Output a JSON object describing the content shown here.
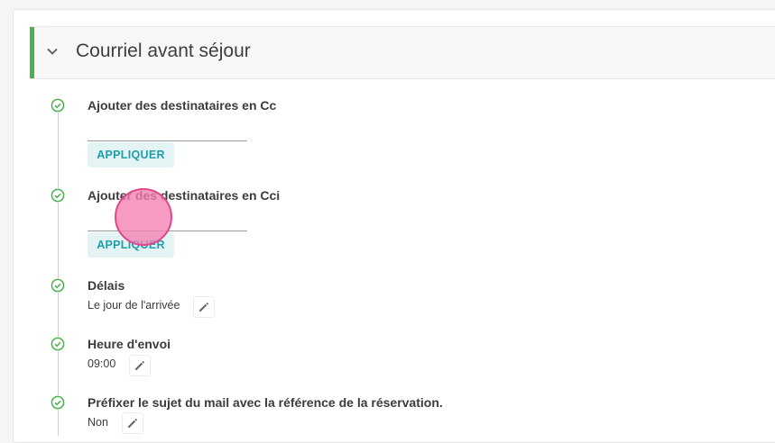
{
  "section": {
    "title": "Courriel avant séjour",
    "accent_color": "#4caf50",
    "toggle_icon": "chevron-down-icon"
  },
  "steps": [
    {
      "title": "Ajouter des destinataires en Cc",
      "input_value": "",
      "apply_label": "APPLIQUER"
    },
    {
      "title": "Ajouter des destinataires en Cci",
      "input_value": "",
      "apply_label": "APPLIQUER"
    },
    {
      "title": "Délais",
      "value": "Le jour de l'arrivée",
      "edit_icon": "pencil-icon"
    },
    {
      "title": "Heure d'envoi",
      "value": "09:00",
      "edit_icon": "pencil-icon"
    },
    {
      "title": "Préfixer le sujet du mail avec la référence de la réservation.",
      "value": "Non",
      "edit_icon": "pencil-icon"
    }
  ],
  "step_status_icon": "check-circle-icon",
  "colors": {
    "check": "#4caf50",
    "apply_text": "#1f9eaa",
    "apply_bg": "#e4f4f5"
  }
}
